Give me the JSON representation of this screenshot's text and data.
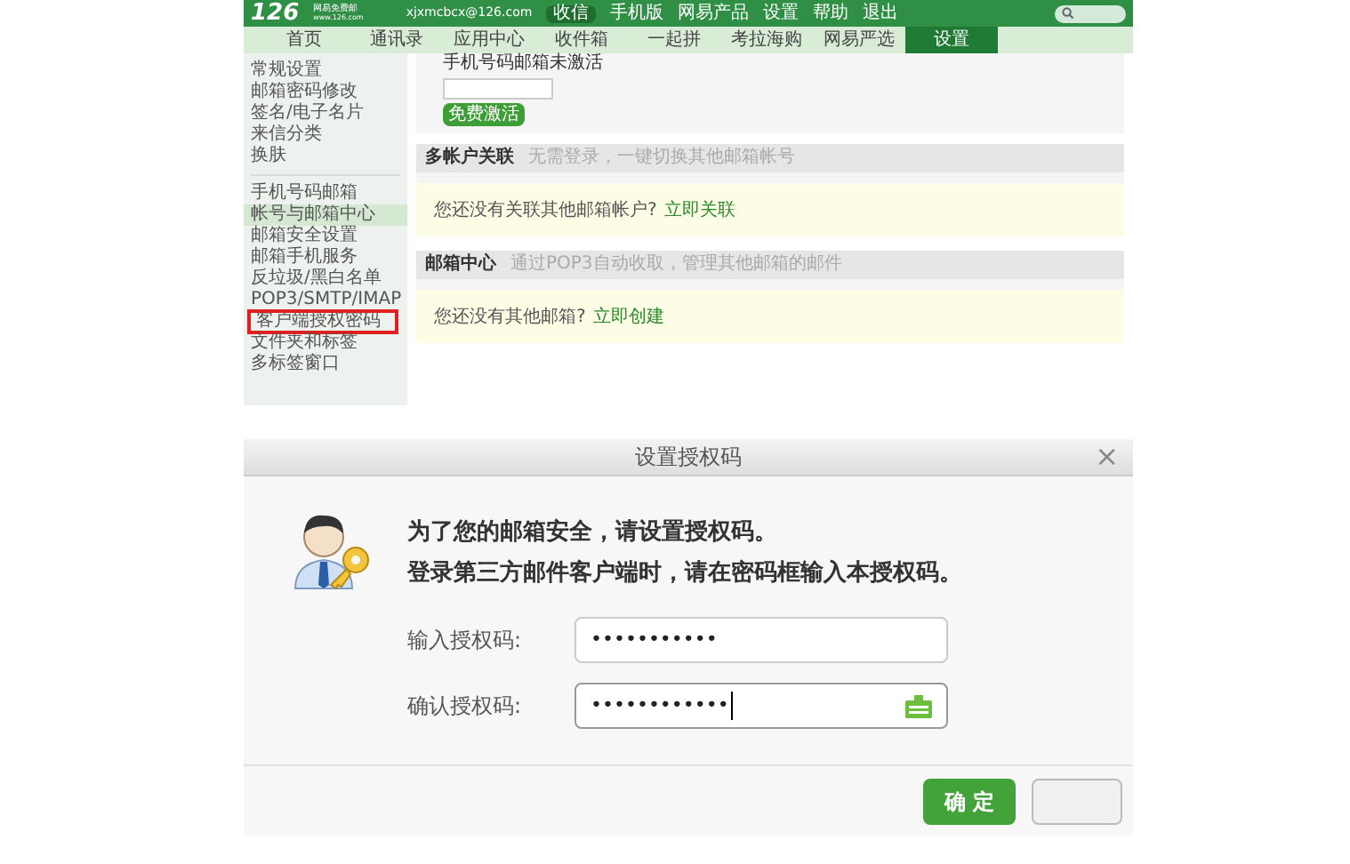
{
  "mail_page": {
    "logo": {
      "mark": "126",
      "name": "网易免费邮",
      "url": "www.126.com"
    },
    "account": "xjxmcbcx@126.com",
    "receive_button": "收信",
    "header_links": [
      "手机版",
      "网易产品",
      "设置",
      "帮助",
      "退出"
    ],
    "tabs": [
      {
        "label": "首页",
        "selected": false
      },
      {
        "label": "通讯录",
        "selected": false
      },
      {
        "label": "应用中心",
        "selected": false
      },
      {
        "label": "收件箱",
        "selected": false
      },
      {
        "label": "一起拼",
        "selected": false
      },
      {
        "label": "考拉海购",
        "selected": false
      },
      {
        "label": "网易严选",
        "selected": false
      },
      {
        "label": "设置",
        "selected": true
      }
    ],
    "sidebar_groups": [
      [
        {
          "label": "常规设置",
          "selected": false,
          "boxed": false
        },
        {
          "label": "邮箱密码修改",
          "selected": false,
          "boxed": false
        },
        {
          "label": "签名/电子名片",
          "selected": false,
          "boxed": false
        },
        {
          "label": "来信分类",
          "selected": false,
          "boxed": false
        },
        {
          "label": "换肤",
          "selected": false,
          "boxed": false
        }
      ],
      [
        {
          "label": "手机号码邮箱",
          "selected": false,
          "boxed": false
        },
        {
          "label": "帐号与邮箱中心",
          "selected": true,
          "boxed": false
        },
        {
          "label": "邮箱安全设置",
          "selected": false,
          "boxed": false
        },
        {
          "label": "邮箱手机服务",
          "selected": false,
          "boxed": false
        },
        {
          "label": "反垃圾/黑白名单",
          "selected": false,
          "boxed": false
        },
        {
          "label": "POP3/SMTP/IMAP",
          "selected": false,
          "boxed": false
        },
        {
          "label": "客户端授权密码",
          "selected": false,
          "boxed": true
        },
        {
          "label": "文件夹和标签",
          "selected": false,
          "boxed": false
        },
        {
          "label": "多标签窗口",
          "selected": false,
          "boxed": false
        }
      ]
    ],
    "activation": {
      "title": "手机号码邮箱未激活",
      "button": "免费激活"
    },
    "sections": [
      {
        "title": "多帐户关联",
        "hint": "无需登录，一键切换其他邮箱帐号",
        "message": "您还没有关联其他邮箱帐户?",
        "link": "立即关联"
      },
      {
        "title": "邮箱中心",
        "hint": "通过POP3自动收取，管理其他邮箱的邮件",
        "message": "您还没有其他邮箱?",
        "link": "立即创建"
      }
    ]
  },
  "dialog": {
    "title": "设置授权码",
    "close": "×",
    "lines": [
      "为了您的邮箱安全，请设置授权码。",
      "登录第三方邮件客户端时，请在密码框输入本授权码。"
    ],
    "fields": [
      {
        "label": "输入授权码:",
        "value": "•••••••••••",
        "focused": false,
        "keyboard": false
      },
      {
        "label": "确认授权码:",
        "value": "••••••••••••",
        "focused": true,
        "keyboard": true
      }
    ],
    "ok_button": "确 定"
  }
}
